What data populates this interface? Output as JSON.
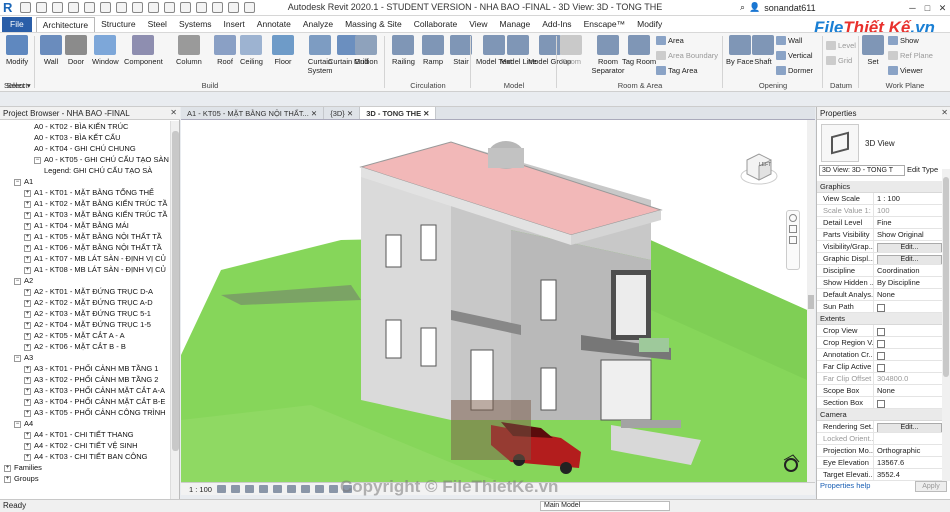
{
  "app": {
    "title": "Autodesk Revit 2020.1 - STUDENT VERSION - NHA BAO -FINAL - 3D View: 3D - TONG THE",
    "username": "sonandat611",
    "brand_main": "File",
    "brand_accent": "Thiết Kế",
    "brand_tail": ".vn",
    "watermark": "Copyright © FileThietKe.vn"
  },
  "tabs": [
    "File",
    "Architecture",
    "Structure",
    "Steel",
    "Systems",
    "Insert",
    "Annotate",
    "Analyze",
    "Massing & Site",
    "Collaborate",
    "View",
    "Manage",
    "Add-Ins",
    "Enscape™",
    "Modify"
  ],
  "active_tab": "Architecture",
  "ribbon": {
    "select_label": "Select ▾",
    "modify": "Modify",
    "build": [
      "Wall",
      "Door",
      "Window",
      "Component",
      "Column",
      "Roof",
      "Ceiling",
      "Floor",
      "Curtain System",
      "Curtain Grid",
      "Mullion"
    ],
    "circulation": [
      "Railing",
      "Ramp",
      "Stair"
    ],
    "model": [
      "Model Text",
      "Model Line",
      "Model Group"
    ],
    "room_area": [
      "Room",
      "Room Separator",
      "Tag Room"
    ],
    "room_area_small": [
      "Area",
      "Area Boundary",
      "Tag Area"
    ],
    "opening": [
      "By Face",
      "Shaft"
    ],
    "opening_small": [
      "Wall",
      "Vertical",
      "Dormer"
    ],
    "datum_small": [
      "Level",
      "Grid"
    ],
    "work_plane": [
      "Set"
    ],
    "work_plane_small": [
      "Show",
      "Ref Plane",
      "Viewer"
    ],
    "panels": [
      "Select",
      "Build",
      "Circulation",
      "Model",
      "Room & Area",
      "Opening",
      "Datum",
      "Work Plane"
    ]
  },
  "project_browser": {
    "title": "Project Browser - NHA BAO -FINAL",
    "items": [
      {
        "t": "A0 - KT02 - BÌA KIẾN TRÚC",
        "l": 3
      },
      {
        "t": "A0 - KT03 - BÌA KẾT CẤU",
        "l": 3
      },
      {
        "t": "A0 - KT04 - GHI CHÚ CHUNG",
        "l": 3
      },
      {
        "t": "A0 - KT05 - GHI CHÚ CẤU TẠO SÀN",
        "l": 3,
        "toggle": "−"
      },
      {
        "t": "Legend: GHI CHÚ CẤU TẠO SÀ",
        "l": 4
      },
      {
        "t": "A1",
        "l": 1,
        "toggle": "−"
      },
      {
        "t": "A1 - KT01 - MẶT BẰNG TỔNG THỂ",
        "l": 2,
        "toggle": "+"
      },
      {
        "t": "A1 - KT02 - MẶT BẰNG KIẾN TRÚC TẦ",
        "l": 2,
        "toggle": "+"
      },
      {
        "t": "A1 - KT03 - MẶT BẰNG KIẾN TRÚC TẦ",
        "l": 2,
        "toggle": "+"
      },
      {
        "t": "A1 - KT04 - MẶT BẰNG MÁI",
        "l": 2,
        "toggle": "+"
      },
      {
        "t": "A1 - KT05 - MẶT BẰNG NỘI THẤT TẦ",
        "l": 2,
        "toggle": "+"
      },
      {
        "t": "A1 - KT06 - MẶT BẰNG NỘI THẤT TẦ",
        "l": 2,
        "toggle": "+"
      },
      {
        "t": "A1 - KT07 - MB LÁT SÀN - ĐỊNH VỊ CỦ",
        "l": 2,
        "toggle": "+"
      },
      {
        "t": "A1 - KT08 - MB LÁT SÀN - ĐỊNH VỊ CỦ",
        "l": 2,
        "toggle": "+"
      },
      {
        "t": "A2",
        "l": 1,
        "toggle": "−"
      },
      {
        "t": "A2 - KT01 - MẶT ĐỨNG TRỤC D-A",
        "l": 2,
        "toggle": "+"
      },
      {
        "t": "A2 - KT02 - MẶT ĐỨNG TRỤC A-D",
        "l": 2,
        "toggle": "+"
      },
      {
        "t": "A2 - KT03 - MẶT ĐỨNG TRỤC 5-1",
        "l": 2,
        "toggle": "+"
      },
      {
        "t": "A2 - KT04 - MẶT ĐỨNG TRỤC 1-5",
        "l": 2,
        "toggle": "+"
      },
      {
        "t": "A2 - KT05 - MẶT CẮT A - A",
        "l": 2,
        "toggle": "+"
      },
      {
        "t": "A2 - KT06 - MẶT CẮT B - B",
        "l": 2,
        "toggle": "+"
      },
      {
        "t": "A3",
        "l": 1,
        "toggle": "−"
      },
      {
        "t": "A3 - KT01 - PHỐI CẢNH MB TẦNG 1",
        "l": 2,
        "toggle": "+"
      },
      {
        "t": "A3 - KT02 - PHỐI CẢNH MB TẦNG 2",
        "l": 2,
        "toggle": "+"
      },
      {
        "t": "A3 - KT03 - PHỐI CẢNH MẶT CẮT A-A",
        "l": 2,
        "toggle": "+"
      },
      {
        "t": "A3 - KT04 - PHỐI CẢNH MẶT CẮT B-E",
        "l": 2,
        "toggle": "+"
      },
      {
        "t": "A3 - KT05 - PHỐI CẢNH CÔNG TRÌNH",
        "l": 2,
        "toggle": "+"
      },
      {
        "t": "A4",
        "l": 1,
        "toggle": "−"
      },
      {
        "t": "A4 - KT01 - CHI TIẾT THANG",
        "l": 2,
        "toggle": "+"
      },
      {
        "t": "A4 - KT02 - CHI TIẾT VỆ SINH",
        "l": 2,
        "toggle": "+"
      },
      {
        "t": "A4 - KT03 - CHI TIẾT BAN CÔNG",
        "l": 2,
        "toggle": "+"
      },
      {
        "t": "Families",
        "l": 0,
        "toggle": "+"
      },
      {
        "t": "Groups",
        "l": 0,
        "toggle": "+"
      }
    ]
  },
  "view_tabs": [
    "A1 - KT05 - MẶT BẰNG NỘI THẤT...",
    "{3D}",
    "3D - TONG THE"
  ],
  "active_view": "3D - TONG THE",
  "view_control": {
    "scale": "1 : 100"
  },
  "cube_label": "LEFT",
  "properties": {
    "title": "Properties",
    "type_name": "3D View",
    "selector": "3D View: 3D - TONG T",
    "edit_type": "Edit Type",
    "sections": [
      {
        "name": "Graphics",
        "rows": [
          {
            "k": "View Scale",
            "v": "1 : 100"
          },
          {
            "k": "Scale Value  1:",
            "v": "100",
            "dis": true
          },
          {
            "k": "Detail Level",
            "v": "Fine"
          },
          {
            "k": "Parts Visibility",
            "v": "Show Original"
          },
          {
            "k": "Visibility/Grap...",
            "v": "Edit...",
            "btn": true
          },
          {
            "k": "Graphic Displ...",
            "v": "Edit...",
            "btn": true
          },
          {
            "k": "Discipline",
            "v": "Coordination"
          },
          {
            "k": "Show Hidden ...",
            "v": "By Discipline"
          },
          {
            "k": "Default Analys...",
            "v": "None"
          },
          {
            "k": "Sun Path",
            "v": "",
            "cb": true
          }
        ]
      },
      {
        "name": "Extents",
        "rows": [
          {
            "k": "Crop View",
            "v": "",
            "cb": true
          },
          {
            "k": "Crop Region V...",
            "v": "",
            "cb": true
          },
          {
            "k": "Annotation Cr...",
            "v": "",
            "cb": true
          },
          {
            "k": "Far Clip Active",
            "v": "",
            "cb": true
          },
          {
            "k": "Far Clip Offset",
            "v": "304800.0",
            "dis": true
          },
          {
            "k": "Scope Box",
            "v": "None"
          },
          {
            "k": "Section Box",
            "v": "",
            "cb": true
          }
        ]
      },
      {
        "name": "Camera",
        "rows": [
          {
            "k": "Rendering Set...",
            "v": "Edit...",
            "btn": true
          },
          {
            "k": "Locked Orient...",
            "v": "",
            "dis": true
          },
          {
            "k": "Projection Mo...",
            "v": "Orthographic"
          },
          {
            "k": "Eye Elevation",
            "v": "13567.6"
          },
          {
            "k": "Target Elevati...",
            "v": "3552.4"
          }
        ]
      }
    ],
    "help": "Properties help",
    "apply": "Apply"
  },
  "status": {
    "text": "Ready",
    "model": "Main Model"
  }
}
